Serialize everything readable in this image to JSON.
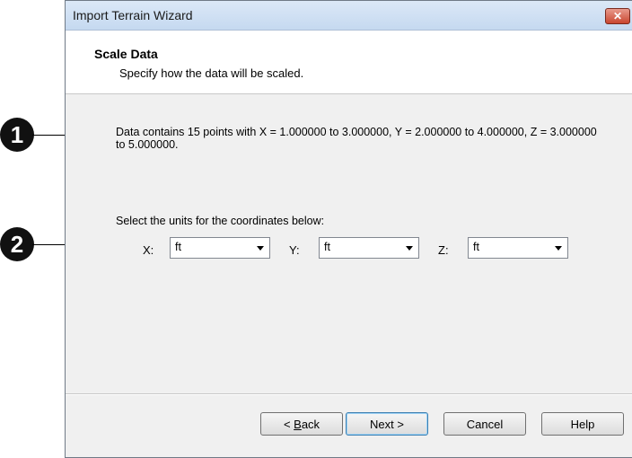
{
  "window": {
    "title": "Import Terrain Wizard",
    "close_glyph": "✕"
  },
  "callouts": [
    "1",
    "2"
  ],
  "header": {
    "title": "Scale Data",
    "subtitle": "Specify how the data will be scaled."
  },
  "info": {
    "text": "Data contains 15 points with X = 1.000000 to 3.000000, Y = 2.000000 to 4.000000, Z = 3.000000 to 5.000000."
  },
  "units": {
    "label": "Select the units for the coordinates below:",
    "x": {
      "label": "X:",
      "value": "ft"
    },
    "y": {
      "label": "Y:",
      "value": "ft"
    },
    "z": {
      "label": "Z:",
      "value": "ft"
    }
  },
  "buttons": {
    "back_mnemonic": "B",
    "back_rest": "ack",
    "back_prefix": "< ",
    "next": "Next >",
    "cancel": "Cancel",
    "help": "Help"
  }
}
